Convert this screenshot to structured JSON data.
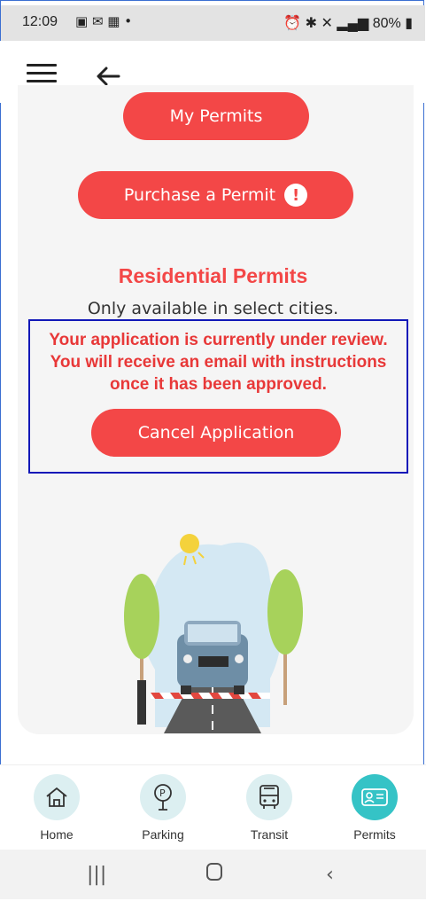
{
  "status_bar": {
    "time": "12:09",
    "battery": "80%"
  },
  "buttons": {
    "my_permits": "My Permits",
    "purchase_permit": "Purchase a Permit",
    "cancel_application": "Cancel Application"
  },
  "residential": {
    "title": "Residential Permits",
    "subtitle": "Only available in select cities."
  },
  "review_message": {
    "line1": "Your application is currently under review.",
    "line2": "You will receive an email with instructions",
    "line3": "once it has been approved."
  },
  "bottom_nav": [
    {
      "label": "Home",
      "icon": "home-icon"
    },
    {
      "label": "Parking",
      "icon": "parking-meter-icon"
    },
    {
      "label": "Transit",
      "icon": "bus-icon"
    },
    {
      "label": "Permits",
      "icon": "permit-card-icon",
      "active": true
    }
  ],
  "colors": {
    "accent": "#f34747",
    "teal": "#35c3c6",
    "highlight_border": "#1218b8"
  }
}
